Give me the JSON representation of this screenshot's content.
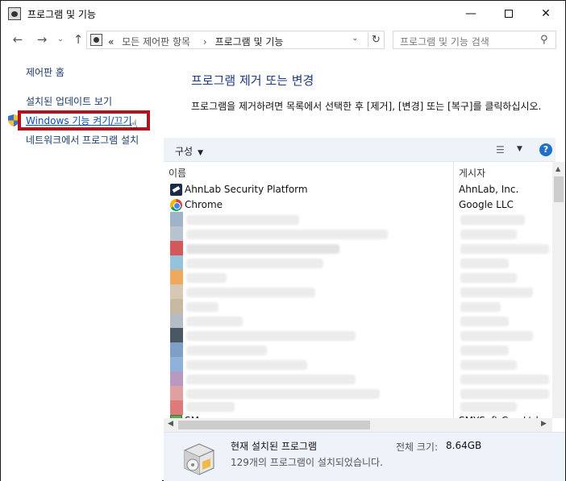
{
  "window": {
    "title": "프로그램 및 기능",
    "min_glyph": "—",
    "close_glyph": "✕"
  },
  "nav": {
    "back_glyph": "←",
    "forward_glyph": "→",
    "recent_glyph": "⌄",
    "up_glyph": "↑",
    "breadcrumb_root": "«",
    "breadcrumb_1": "모든 제어판 항목",
    "breadcrumb_sep": "›",
    "breadcrumb_2": "프로그램 및 기능",
    "dropdown_glyph": "⌄",
    "refresh_glyph": "↻",
    "search_placeholder": "프로그램 및 기능 검색",
    "search_glyph": "⚲"
  },
  "sidebar": {
    "home": "제어판 홈",
    "updates": "설치된 업데이트 보기",
    "features": "Windows 기능 켜기/끄기",
    "network": "네트워크에서 프로그램 설치",
    "cursor_glyph": "☝"
  },
  "main": {
    "heading": "프로그램 제거 또는 변경",
    "description": "프로그램을 제거하려면 목록에서 선택한 후 [제거], [변경] 또는 [복구]를 클릭하십시오."
  },
  "toolbar": {
    "organize": "구성",
    "caret": "▼",
    "view_glyph": "☰",
    "help_glyph": "?"
  },
  "list": {
    "columns": {
      "name": "이름",
      "publisher": "게시자"
    },
    "rows": [
      {
        "name": "AhnLab Security Platform",
        "publisher": "AhnLab, Inc.",
        "icon": "ahnlab-icon"
      },
      {
        "name": "Chrome",
        "publisher": "Google LLC",
        "icon": "chrome-icon"
      },
      {
        "name": "SMemo",
        "publisher": "SMYSoft Co., Ltd.",
        "icon": "memo-icon"
      }
    ],
    "scroll_up": "▲",
    "scroll_left": "◀",
    "scroll_right": "▶"
  },
  "details": {
    "title": "현재 설치된 프로그램",
    "subtitle": "129개의 프로그램이 설치되었습니다.",
    "size_label": "전체 크기:",
    "size_value": "8.64GB"
  },
  "colors": {
    "highlight_border": "#b0131d",
    "heading": "#1e3a8a",
    "link": "#1a3c6e",
    "toolbar_bg": "#eef3fa"
  }
}
